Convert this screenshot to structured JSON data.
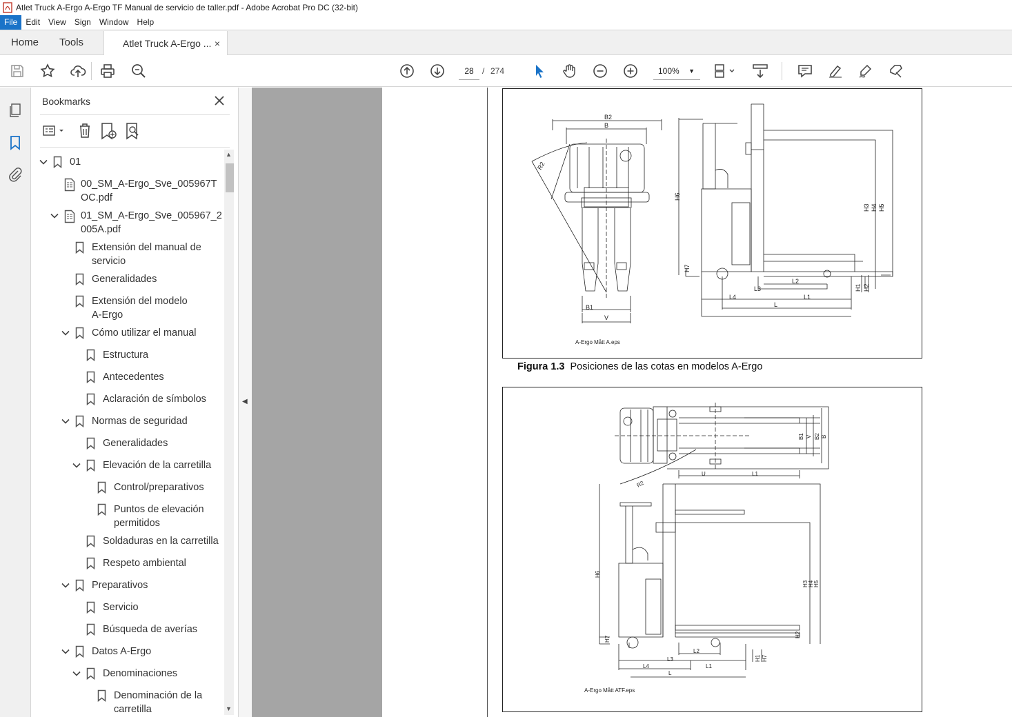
{
  "window": {
    "title": "Atlet Truck A-Ergo A-Ergo TF Manual de servicio de taller.pdf - Adobe Acrobat Pro DC (32-bit)"
  },
  "menu": [
    "File",
    "Edit",
    "View",
    "Sign",
    "Window",
    "Help"
  ],
  "tabs": {
    "home": "Home",
    "tools": "Tools",
    "doc": "Atlet Truck A-Ergo ...",
    "close": "×"
  },
  "toolbar": {
    "page_current": "28",
    "page_sep": "/",
    "page_total": "274",
    "zoom": "100%"
  },
  "bookmarks": {
    "title": "Bookmarks",
    "items": [
      {
        "label": "01"
      },
      {
        "label": "00_SM_A-Ergo_Sve_005967TOC.pdf"
      },
      {
        "label": "01_SM_A-Ergo_Sve_005967_2005A.pdf"
      },
      {
        "label": "Extensión del manual de servicio"
      },
      {
        "label": "Generalidades"
      },
      {
        "label": "Extensión del modelo A-Ergo"
      },
      {
        "label": "Cómo utilizar el manual"
      },
      {
        "label": "Estructura"
      },
      {
        "label": "Antecedentes"
      },
      {
        "label": "Aclaración de símbolos"
      },
      {
        "label": "Normas de seguridad"
      },
      {
        "label": "Generalidades"
      },
      {
        "label": "Elevación de la carretilla"
      },
      {
        "label": "Control/preparativos"
      },
      {
        "label": "Puntos de elevación permitidos"
      },
      {
        "label": "Soldaduras en la carretilla"
      },
      {
        "label": "Respeto ambiental"
      },
      {
        "label": "Preparativos"
      },
      {
        "label": "Servicio"
      },
      {
        "label": "Búsqueda de averías"
      },
      {
        "label": "Datos A-Ergo"
      },
      {
        "label": "Denominaciones"
      },
      {
        "label": "Denominación de la carretilla"
      }
    ]
  },
  "document": {
    "figure1": {
      "eps": "A-Ergo Mått A.eps",
      "labels": {
        "B2": "B2",
        "B": "B",
        "R2": "R2",
        "B1": "B1",
        "V": "V",
        "H6": "H6",
        "H7": "H7",
        "H3": "H3",
        "H4": "H4",
        "H5": "H5",
        "H1": "H1",
        "H2": "H2",
        "L2": "L2",
        "L3": "L3",
        "L4": "L4",
        "L1": "L1",
        "L": "L"
      }
    },
    "caption_num": "Figura 1.3",
    "caption_text": "Posiciones de las cotas en modelos A-Ergo",
    "figure2": {
      "eps": "A-Ergo Mått ATF.eps",
      "labels": {
        "B1": "B1",
        "V": "V",
        "B2": "B2",
        "B": "B",
        "U": "U",
        "L1": "L1",
        "R2": "R2",
        "H6": "H6",
        "H7": "H7",
        "H3": "H3",
        "H4": "H4",
        "H5": "H5",
        "H2": "H2",
        "L2": "L2",
        "L3": "L3",
        "H1": "H1",
        "L4": "L4",
        "L": "L"
      }
    }
  }
}
